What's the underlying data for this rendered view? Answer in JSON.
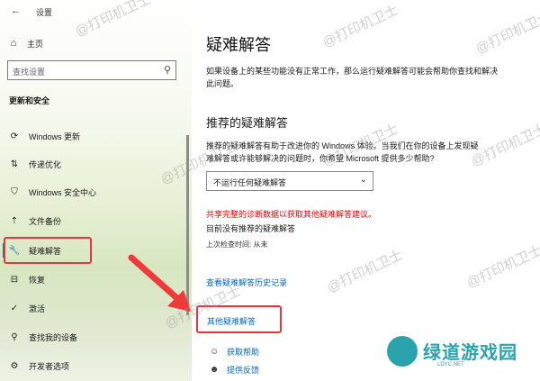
{
  "window": {
    "title": "设置",
    "back_glyph": "←"
  },
  "sidebar": {
    "home": "主页",
    "search_placeholder": "查找设置",
    "section": "更新和安全",
    "items": [
      {
        "label": "Windows 更新",
        "icon": "refresh-icon",
        "glyph": "⟳"
      },
      {
        "label": "传递优化",
        "icon": "delivery-icon",
        "glyph": "⇅"
      },
      {
        "label": "Windows 安全中心",
        "icon": "shield-icon",
        "glyph": "⛉"
      },
      {
        "label": "文件备份",
        "icon": "backup-icon",
        "glyph": "⇡"
      },
      {
        "label": "疑难解答",
        "icon": "wrench-icon",
        "glyph": "🔧"
      },
      {
        "label": "恢复",
        "icon": "recovery-icon",
        "glyph": "⊟"
      },
      {
        "label": "激活",
        "icon": "check-circle-icon",
        "glyph": "✓"
      },
      {
        "label": "查找我的设备",
        "icon": "person-search-icon",
        "glyph": "⚲"
      },
      {
        "label": "开发者选项",
        "icon": "developer-icon",
        "glyph": "⚙"
      }
    ]
  },
  "main": {
    "title": "疑难解答",
    "intro": "如果设备上的某些功能没有正常工作，那么运行疑难解答可能会帮助你查找和解决此问题。",
    "recommended_heading": "推荐的疑难解答",
    "recommended_desc": "推荐的疑难解答有助于改进你的 Windows 体验。当我们在你的设备上发现疑难解答或许能够解决的问题时，你希望 Microsoft 提供多少帮助?",
    "dropdown_value": "不运行任何疑难解答",
    "warning": "共享完整的诊断数据以获取其他疑难解答建议。",
    "no_recommended": "目前没有推荐的疑难解答",
    "last_check": "上次检查时间: 从未",
    "history_link": "查看疑难解答历史记录",
    "other_link": "其他疑难解答",
    "get_help": "获取帮助",
    "feedback": "提供反馈"
  },
  "watermark": "@打印机卫士",
  "logo": {
    "name": "绿道游戏园",
    "sub": "LDYC.NET"
  },
  "colors": {
    "accent": "#0078d4",
    "highlight": "#e8343a",
    "link": "#0067c0"
  }
}
